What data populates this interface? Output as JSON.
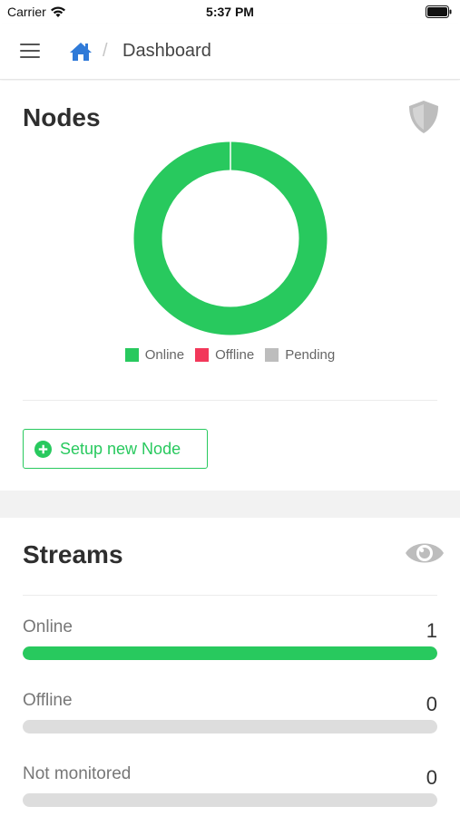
{
  "status_bar": {
    "carrier": "Carrier",
    "time": "5:37 PM"
  },
  "header": {
    "breadcrumb_current": "Dashboard",
    "breadcrumb_separator": "/",
    "home_icon": "home-icon",
    "menu_icon": "hamburger-menu-icon"
  },
  "nodes": {
    "title": "Nodes",
    "icon": "shield-icon",
    "chart_data": {
      "type": "pie",
      "categories": [
        "Online",
        "Offline",
        "Pending"
      ],
      "values": [
        1,
        0,
        0
      ],
      "colors": [
        "#28c95e",
        "#f2385a",
        "#bdbdbd"
      ],
      "legend_position": "bottom"
    },
    "setup_button_label": "Setup new Node",
    "setup_button_icon": "plus-circle-icon"
  },
  "streams": {
    "title": "Streams",
    "icon": "eye-icon",
    "rows": [
      {
        "label": "Online",
        "count": "1",
        "fraction": 1
      },
      {
        "label": "Offline",
        "count": "0",
        "fraction": 0
      },
      {
        "label": "Not monitored",
        "count": "0",
        "fraction": 0
      }
    ]
  },
  "colors": {
    "accent": "#28c95e",
    "link": "#2f7ad8",
    "track": "#dddddd"
  }
}
